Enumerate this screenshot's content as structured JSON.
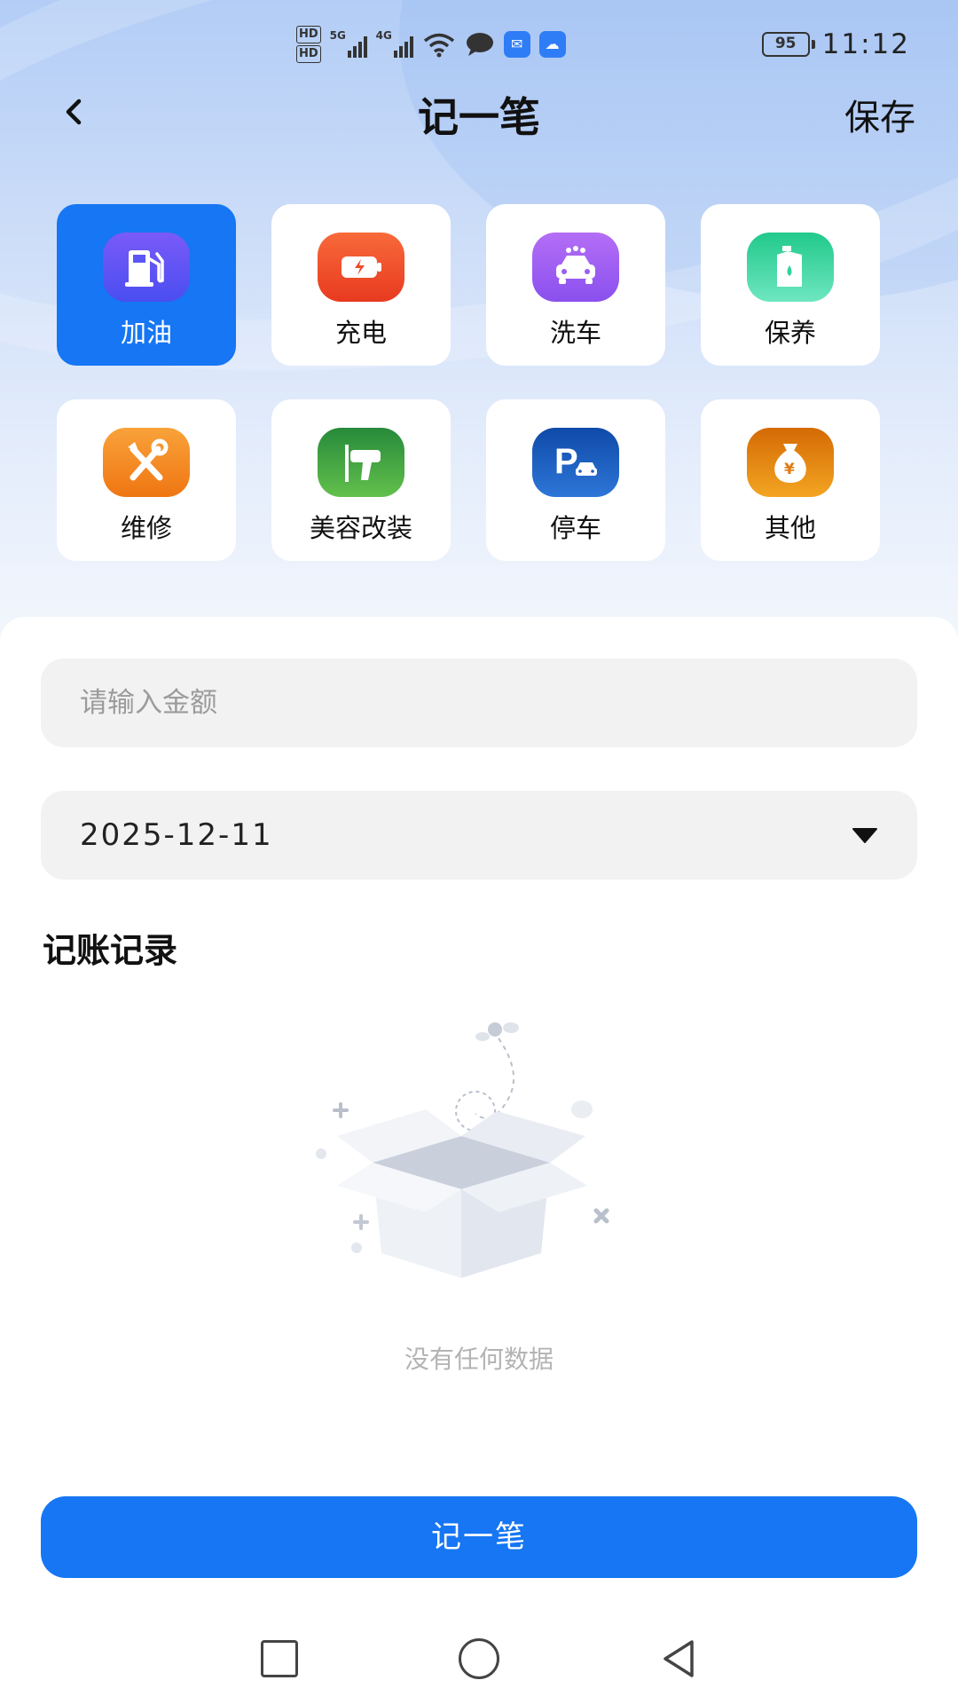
{
  "status_bar": {
    "hd1": "HD",
    "hd2": "HD",
    "network1": "5G",
    "network2": "4G",
    "battery": "95",
    "time": "11:12"
  },
  "header": {
    "title": "记一笔",
    "save_label": "保存",
    "back_icon": "chevron-left-icon"
  },
  "categories": [
    {
      "label": "加油",
      "icon": "fuel-pump-icon",
      "color": "#5b56f5",
      "selected": true
    },
    {
      "label": "充电",
      "icon": "battery-charge-icon",
      "color": "#f04a2a",
      "selected": false
    },
    {
      "label": "洗车",
      "icon": "car-wash-icon",
      "color": "#9a5ff0",
      "selected": false
    },
    {
      "label": "保养",
      "icon": "oil-can-icon",
      "color": "#2fd3a0",
      "selected": false
    },
    {
      "label": "维修",
      "icon": "wrench-screwdriver-icon",
      "color": "#f58a1f",
      "selected": false
    },
    {
      "label": "美容改装",
      "icon": "polisher-drill-icon",
      "color": "#3aa043",
      "selected": false
    },
    {
      "label": "停车",
      "icon": "parking-icon",
      "color": "#1a5fbf",
      "selected": false
    },
    {
      "label": "其他",
      "icon": "money-bag-icon",
      "color": "#e07a10",
      "selected": false
    }
  ],
  "form": {
    "amount_placeholder": "请输入金额",
    "amount_value": "",
    "date_value": "2025-12-11"
  },
  "records": {
    "title": "记账记录",
    "empty_text": "没有任何数据"
  },
  "submit_label": "记一笔",
  "colors": {
    "primary": "#1676f3",
    "field_bg": "#f2f2f3",
    "muted_text": "#b3b3b3"
  }
}
